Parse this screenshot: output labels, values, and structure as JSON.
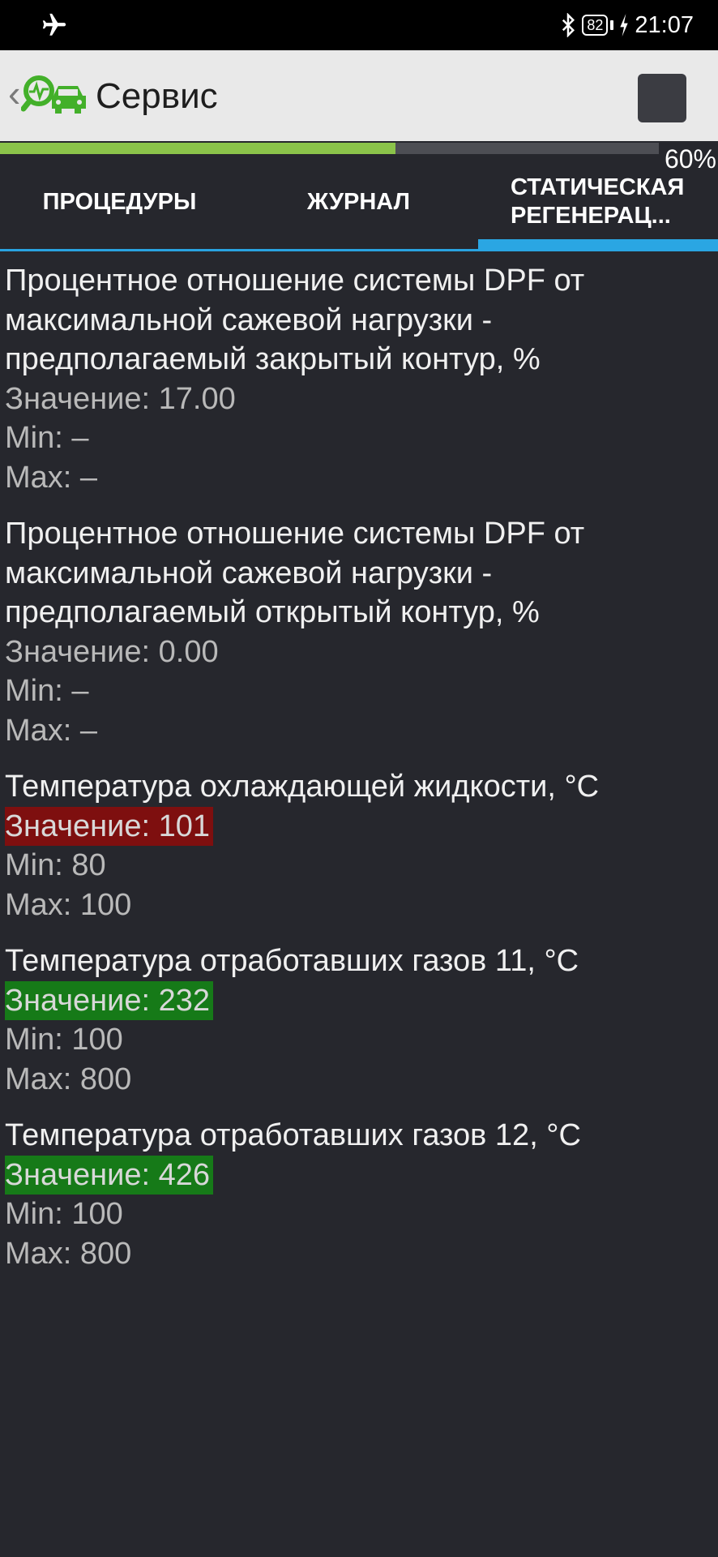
{
  "status_bar": {
    "airplane_icon": "airplane-icon",
    "bluetooth_icon": "bluetooth-icon",
    "battery_level": "82",
    "charging_icon": "bolt-icon",
    "time": "21:07"
  },
  "app_bar": {
    "back_glyph": "‹",
    "logo_icon": "car-diagnostic-logo-icon",
    "title": "Сервис",
    "stop_icon": "stop-icon"
  },
  "progress": {
    "value": 0.6,
    "label": "60%"
  },
  "tabs": [
    {
      "label": "ПРОЦЕДУРЫ",
      "selected": false
    },
    {
      "label": "ЖУРНАЛ",
      "selected": false
    },
    {
      "label": "СТАТИЧЕСКАЯ\nРЕГЕНЕРАЦ...",
      "selected": true
    }
  ],
  "params": [
    {
      "title": "Процентное отношение системы DPF от максимальной сажевой нагрузки - предполагаемый закрытый контур, %",
      "value": "Значение: 17.00",
      "min": "Min:  –",
      "max": "Max:  –"
    },
    {
      "title": "Процентное отношение системы DPF от максимальной сажевой нагрузки - предполагаемый открытый контур, %",
      "value": "Значение: 0.00",
      "min": "Min:  –",
      "max": "Max:  –"
    },
    {
      "title": "Температура охлаждающей жидкости, °C",
      "value": "Значение: 101",
      "min": "Min: 80",
      "max": "Max: 100"
    },
    {
      "title": "Температура отработавших газов 11, °C",
      "value": "Значение: 232",
      "min": "Min: 100",
      "max": "Max: 800"
    },
    {
      "title": "Температура отработавших газов 12, °C",
      "value": "Значение: 426",
      "min": "Min: 100",
      "max": "Max: 800"
    }
  ],
  "colors": {
    "background": "#26272d",
    "progress_fill": "#8bc34a",
    "tab_indicator": "#2aa6e3",
    "value_alarm": "#7e0f0f",
    "value_ok": "#167a18"
  }
}
